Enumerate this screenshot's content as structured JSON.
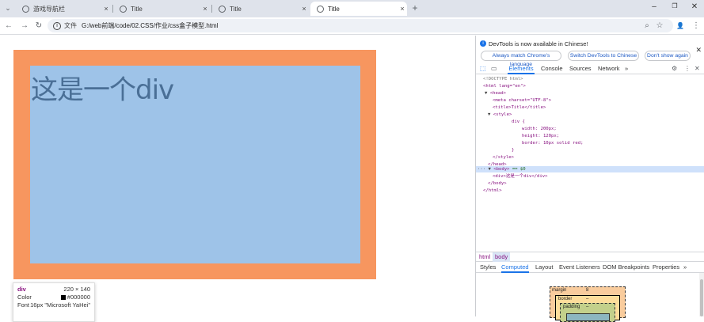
{
  "browser": {
    "tabs": [
      {
        "label": "游戏导航栏",
        "close": "×"
      },
      {
        "label": "Title",
        "close": "×"
      },
      {
        "label": "Title",
        "close": "×"
      },
      {
        "label": "Title",
        "close": "×",
        "active": true
      }
    ],
    "new_tab": "+",
    "tab_menu": "⌄",
    "window_controls": {
      "minimize": "–",
      "maximize": "❐",
      "close": "✕"
    },
    "nav": {
      "back": "←",
      "forward": "→",
      "reload": "↻"
    },
    "address": {
      "chip": "文件",
      "url": "G:/web前端/code/02.CSS/作业/css盒子模型.html"
    },
    "toolbar_icons": {
      "zoom": "⌕",
      "bookmark": "☆",
      "profile": "👤",
      "menu": "⋮"
    }
  },
  "page": {
    "div_text": "这是一个div",
    "colors": {
      "border": "#f7965f",
      "content": "#9ec3e8",
      "text": "#4a6f96"
    },
    "tooltip": {
      "tag": "div",
      "size": "220 × 140",
      "color_label": "Color",
      "color_value": "#000000",
      "font_label": "Font",
      "font_value": "16px \"Microsoft YaHei\""
    }
  },
  "devtools": {
    "banner": {
      "text": "DevTools is now available in Chinese!",
      "btn_match": "Always match Chrome's language",
      "btn_switch": "Switch DevTools to Chinese",
      "btn_dont": "Don't show again",
      "close": "✕"
    },
    "tabs": [
      "Elements",
      "Console",
      "Sources",
      "Network"
    ],
    "more_tabs": "»",
    "settings": "⚙",
    "kebab": "⋮",
    "close": "✕",
    "dom": {
      "doctype": "<!DOCTYPE html>",
      "html_open": "<html lang=\"en\">",
      "head_open": "<head>",
      "meta": "<meta charset=\"UTF-8\">",
      "title": "<title>Title</title>",
      "style_open": "<style>",
      "css_selector": "div {",
      "css_width": "width: 200px;",
      "css_height": "height: 120px;",
      "css_border": "border: 10px solid red;",
      "css_close": "}",
      "style_close": "</style>",
      "head_close": "</head>",
      "body_open": "<body>",
      "body_marker": "== $0",
      "div_line": "<div>这是一个div</div>",
      "body_close": "</body>",
      "html_close": "</html>"
    },
    "breadcrumbs": [
      "html",
      "body"
    ],
    "sub_tabs": [
      "Styles",
      "Computed",
      "Layout",
      "Event Listeners",
      "DOM Breakpoints",
      "Properties"
    ],
    "sub_more": "»",
    "box_model": {
      "margin_label": "margin",
      "margin_value": "8",
      "border_label": "border",
      "border_value": "–",
      "padding_label": "padding",
      "padding_value": "–"
    }
  }
}
